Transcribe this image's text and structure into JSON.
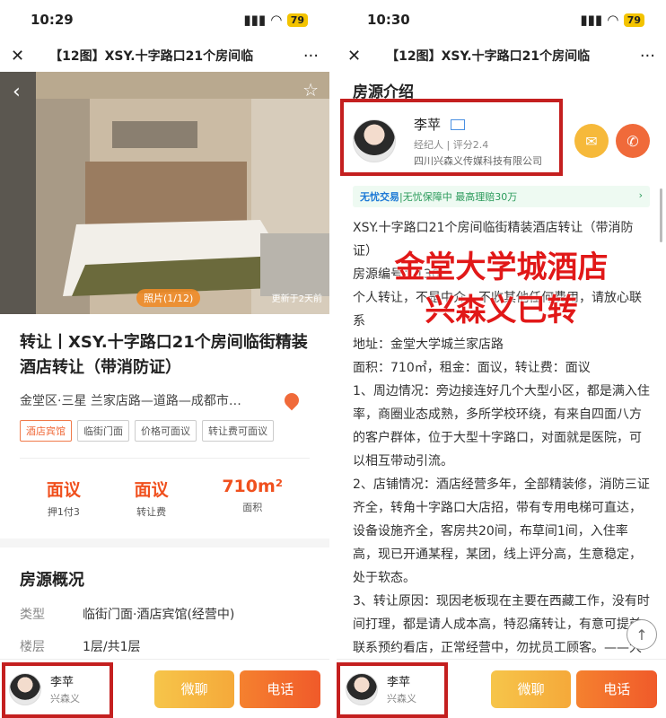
{
  "left": {
    "status": {
      "time": "10:29",
      "battery": "79"
    },
    "nav": {
      "title": "【12图】XSY.十字路口21个房间临",
      "close": "✕",
      "more": "···"
    },
    "hero": {
      "photo_count": "照片(1/12)",
      "updated": "更新于2天前"
    },
    "title": "转让丨XSY.十字路口21个房间临街精装酒店转让（带消防证）",
    "address": "金堂区·三星 兰家店路—道路—成都市…",
    "tags": [
      "酒店宾馆",
      "临街门面",
      "价格可面议",
      "转让费可面议"
    ],
    "stats": [
      {
        "value": "面议",
        "label": "押1付3"
      },
      {
        "value": "面议",
        "label": "转让费"
      },
      {
        "value": "710m²",
        "label": "面积"
      }
    ],
    "overview_title": "房源概况",
    "overview": [
      {
        "key": "类型",
        "value": "临街门面·酒店宾馆(经营中)"
      },
      {
        "key": "楼层",
        "value": "1层/共1层"
      }
    ]
  },
  "right": {
    "status": {
      "time": "10:30",
      "battery": "79"
    },
    "nav": {
      "title": "【12图】XSY.十字路口21个房间临",
      "close": "✕",
      "more": "···"
    },
    "section_title": "房源介绍",
    "agent": {
      "name": "李苹",
      "role": "经纪人",
      "rating": "评分2.4",
      "company": "四川兴森义传媒科技有限公司"
    },
    "guarantee": {
      "brand": "无忧交易",
      "text": "|无忧保障中 最高理赔30万"
    },
    "overlay": {
      "line1": "金堂大学城酒店",
      "line2": "兴森义已转"
    },
    "description": [
      "XSY.十字路口21个房间临街精装酒店转让（带消防证）",
      "房源编号：130",
      "个人转让，不是中介，不收其他任何费用，请放心联系",
      "地址：金堂大学城兰家店路",
      "面积：710㎡，租金：面议，转让费：面议",
      "1、周边情况：旁边接连好几个大型小区，都是满入住率，商圈业态成熟，多所学校环绕，有来自四面八方的客户群体，位于大型十字路口，对面就是医院，可以相互带动引流。",
      "2、店铺情况：酒店经营多年，全部精装修，消防三证齐全，转角十字路口大店招，带有专用电梯可直达，设备设施齐全，客房共20间，布草间1间，入住率高，现已开通某程，某团，线上评分高，生意稳定，处于软态。",
      "3、转让原因：现因老板现在主要在西藏工作，没有时间打理，都是请人成本高，特忍痛转让，有意可提前联系预约看店，正常经营中，勿扰员工顾客。——大彭、琴妹儿"
    ]
  },
  "bottombar": {
    "agent_name": "李苹",
    "agent_company": "兴森义",
    "chat_label": "微聊",
    "call_label": "电话"
  },
  "colors": {
    "accent": "#f0501e",
    "highlight_box": "#c41f1f"
  }
}
